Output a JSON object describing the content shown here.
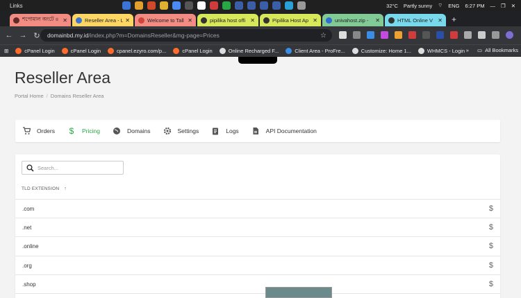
{
  "taskbar": {
    "links_label": "Links",
    "weather": "32°C",
    "weather_desc": "Partly sunny",
    "lang": "ENG",
    "time": "6:27 PM"
  },
  "tabs": [
    {
      "title": "শপোমাল অংটে ৪",
      "color": "#f28b82"
    },
    {
      "title": "Reseller Area - L",
      "color": "#fdd663"
    },
    {
      "title": "Welcome to Tall",
      "color": "#f28b82"
    },
    {
      "title": "pipilika host offi",
      "color": "#d7e85a"
    },
    {
      "title": "Pipilika Host Ap",
      "color": "#d7e85a"
    },
    {
      "title": "univahost.zip -",
      "color": "#81c995"
    },
    {
      "title": "HTML Online V",
      "color": "#78d9ec"
    }
  ],
  "toolbar": {
    "url_host": "domainbd.my.id",
    "url_path": "/index.php?m=DomainsReseller&mg-page=Prices"
  },
  "bookmarks": [
    "cPanel Login",
    "cPanel Login",
    "cpanel.ezyro.com/p...",
    "cPanel Login",
    "Online Recharged F...",
    "Client Area - ProFre...",
    "Customize: Home 1...",
    "WHMCS - Login"
  ],
  "all_bookmarks": "All Bookmarks",
  "page": {
    "title": "Reseller Area",
    "breadcrumb": [
      "Portal Home",
      "Domains Reseller Area"
    ],
    "nav": [
      "Orders",
      "Pricing",
      "Domains",
      "Settings",
      "Logs",
      "API Documentation"
    ],
    "search_placeholder": "Search...",
    "column_header": "TLD EXTENSION",
    "rows": [
      ".com",
      ".net",
      ".online",
      ".org",
      ".shop"
    ],
    "price_symbol": "$"
  },
  "colors": {
    "accent": "#28a745",
    "tab_active": "#fdd663"
  }
}
